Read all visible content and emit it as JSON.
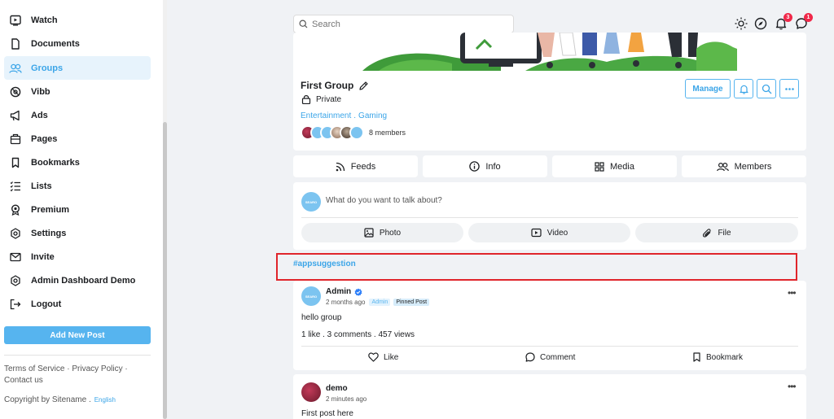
{
  "sidebar": {
    "items": [
      {
        "label": "Watch",
        "icon": "play-box-icon"
      },
      {
        "label": "Documents",
        "icon": "document-icon"
      },
      {
        "label": "Groups",
        "icon": "groups-icon",
        "active": true
      },
      {
        "label": "Vibb",
        "icon": "vibb-icon"
      },
      {
        "label": "Ads",
        "icon": "megaphone-icon"
      },
      {
        "label": "Pages",
        "icon": "pages-icon"
      },
      {
        "label": "Bookmarks",
        "icon": "bookmark-icon"
      },
      {
        "label": "Lists",
        "icon": "list-icon"
      },
      {
        "label": "Premium",
        "icon": "award-icon"
      },
      {
        "label": "Settings",
        "icon": "gear-icon"
      },
      {
        "label": "Invite",
        "icon": "mail-icon"
      },
      {
        "label": "Admin Dashboard Demo",
        "icon": "gear-icon"
      },
      {
        "label": "Logout",
        "icon": "logout-icon"
      }
    ],
    "add_post_label": "Add New Post",
    "footer": {
      "terms": "Terms of Service",
      "privacy": "Privacy Policy",
      "contact": "Contact us",
      "dot": "·",
      "copyright": "Copyright by Sitename .",
      "language": "English"
    }
  },
  "topbar": {
    "search_placeholder": "Search",
    "notifications_badge": "3",
    "messages_badge": "1"
  },
  "group": {
    "title": "First Group",
    "privacy": "Private",
    "categories": [
      "Entertainment",
      "Gaming"
    ],
    "category_separator": ".",
    "members_count": "8 members",
    "manage_label": "Manage"
  },
  "tabs": [
    {
      "label": "Feeds",
      "icon": "rss-icon"
    },
    {
      "label": "Info",
      "icon": "info-icon"
    },
    {
      "label": "Media",
      "icon": "grid-icon"
    },
    {
      "label": "Members",
      "icon": "members-icon"
    }
  ],
  "composer": {
    "avatar_text": "SEARO",
    "placeholder": "What do you want to talk about?",
    "photo_label": "Photo",
    "video_label": "Video",
    "file_label": "File"
  },
  "hashtag": "#appsuggestion",
  "posts": [
    {
      "author": "Admin",
      "avatar_text": "SEARO",
      "time": "2 months ago",
      "role_badge": "Admin",
      "pinned_badge": "Pinned Post",
      "text": "hello group",
      "stats": "1 like . 3 comments . 457 views",
      "like_label": "Like",
      "comment_label": "Comment",
      "bookmark_label": "Bookmark",
      "more": "•••"
    },
    {
      "author": "demo",
      "time": "2 minutes ago",
      "text": "First post here",
      "more": "•••"
    }
  ],
  "colors": {
    "accent": "#3ba5e8",
    "button": "#56b4ef",
    "highlight_box": "#e0252b",
    "badge": "#f02849"
  }
}
